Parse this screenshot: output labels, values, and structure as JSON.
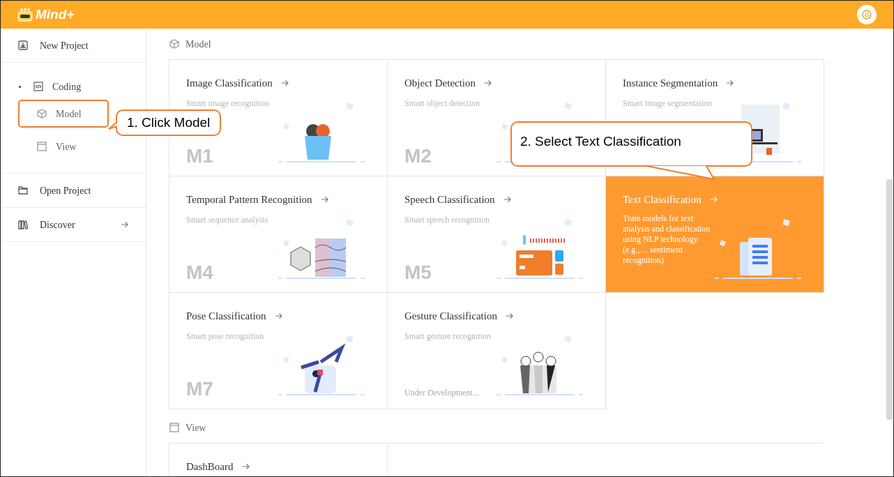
{
  "header": {
    "logo_text": "Mind+"
  },
  "sidebar": {
    "items": [
      {
        "kind": "item",
        "label": "New Project",
        "arrow": false
      },
      {
        "kind": "group",
        "label": "Coding",
        "active": true,
        "children": [
          {
            "label": "Model",
            "highlighted": true
          },
          {
            "label": "View",
            "highlighted": false
          }
        ]
      },
      {
        "kind": "item",
        "label": "Open Project",
        "arrow": false
      },
      {
        "kind": "item",
        "label": "Discover",
        "arrow": true
      }
    ]
  },
  "sections": [
    {
      "title": "Model",
      "cards": [
        {
          "title": "Image Classification",
          "subtitle": "Smart image recognition",
          "code": "M1",
          "selected": false
        },
        {
          "title": "Object Detection",
          "subtitle": "Smart object detection",
          "code": "M2",
          "selected": false
        },
        {
          "title": "Instance Segmentation",
          "subtitle": "Smart image segmentation",
          "selected": false
        },
        {
          "title": "Temporal Pattern Recognition",
          "subtitle": "Smart sequence analysis",
          "code": "M4",
          "selected": false
        },
        {
          "title": "Speech Classification",
          "subtitle": "Smart speech recognition",
          "code": "M5",
          "selected": false
        },
        {
          "title": "Text Classification",
          "subtitle": "Train models for text analysis and classification using NLP technology (e.g.,… sentiment recognition)",
          "selected": true
        },
        {
          "title": "Pose Classification",
          "subtitle": "Smart pose recognition",
          "code": "M7",
          "selected": false
        },
        {
          "title": "Gesture Classification",
          "subtitle": "Smart gesture recognition",
          "note": "Under Development...",
          "selected": false
        }
      ]
    },
    {
      "title": "View",
      "cards": [
        {
          "title": "DashBoard",
          "selected": false
        }
      ]
    }
  ],
  "callouts": [
    {
      "text": "1. Click Model"
    },
    {
      "text": "2. Select Text Classification"
    }
  ]
}
